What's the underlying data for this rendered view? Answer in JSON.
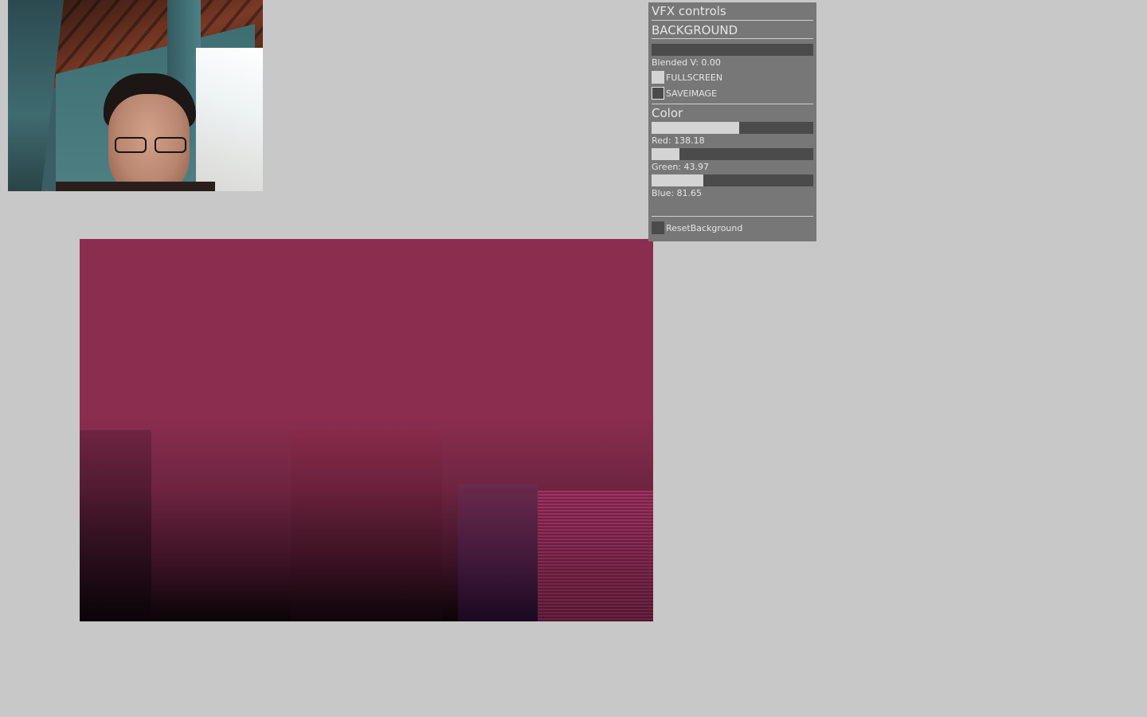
{
  "panel": {
    "title": "VFX controls",
    "background_section": "BACKGROUND",
    "blended_label": "Blended V: 0.00",
    "blended_fraction": 0.0,
    "fullscreen_label": "FULLSCREEN",
    "fullscreen_on": true,
    "saveimage_label": "SAVEIMAGE",
    "saveimage_on": false,
    "color_section": "Color",
    "red_label": "Red: 138.18",
    "red_fraction": 0.5419,
    "green_label": "Green: 43.97",
    "green_fraction": 0.1724,
    "blue_label": "Blue: 81.65",
    "blue_fraction": 0.3202,
    "reset_label": "ResetBackground"
  },
  "colors": {
    "background": "#c8c8c8",
    "panel": "#777777",
    "slider_track": "#4b4b4b",
    "slider_fill": "#d4d4d4",
    "output_tint": "#8a2d4f"
  }
}
